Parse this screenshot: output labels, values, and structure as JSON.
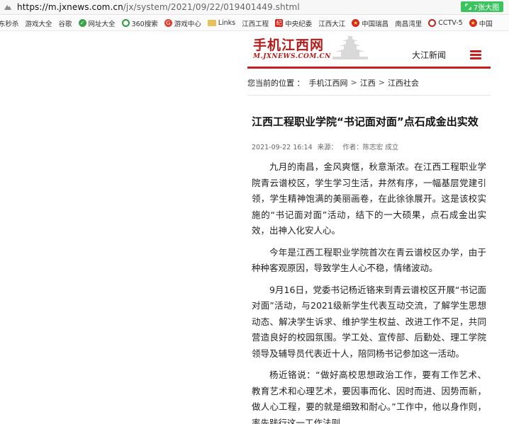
{
  "browser": {
    "url_host": "https://m.jxnews.com.cn",
    "url_path": "/jx/system/2021/09/22/019401449.shtml",
    "image_button": "7张大图"
  },
  "bookmarks": [
    {
      "label": "东秒杀",
      "icon": "none"
    },
    {
      "label": "游戏大全",
      "icon": "page"
    },
    {
      "label": "谷歌",
      "icon": "page"
    },
    {
      "label": "网址大全",
      "icon": "green"
    },
    {
      "label": "360搜索",
      "icon": "ring"
    },
    {
      "label": "游戏中心",
      "icon": "game"
    },
    {
      "label": "Links",
      "icon": "folder"
    },
    {
      "label": "江西工程",
      "icon": "page"
    },
    {
      "label": "中央纪委",
      "icon": "red"
    },
    {
      "label": "江西大江",
      "icon": "page"
    },
    {
      "label": "中国瑞昌",
      "icon": "emblem"
    },
    {
      "label": "南昌湾里",
      "icon": "page"
    },
    {
      "label": "CCTV-5",
      "icon": "cctv"
    },
    {
      "label": "中国",
      "icon": "emblem"
    }
  ],
  "header": {
    "logo_cn": "手机江西网",
    "logo_en": "M.JXNEWS.COM.CN",
    "channel": "大江新闻"
  },
  "breadcrumb": {
    "label": "您当前的位置 ：",
    "items": [
      "手机江西网",
      "江西",
      "江西社会"
    ],
    "separator": ">"
  },
  "article": {
    "title": "江西工程职业学院“书记面对面”点石成金出实效",
    "date": "2021-09-22 16:14",
    "source_label": "来源：",
    "author": "作者：陈志宏 成立",
    "paragraphs": [
      "九月的南昌，金风爽惬，秋意渐浓。在江西工程职业学院青云谱校区，学生学习生活，井然有序，一幅基层党建引领，学生精神饱满的美丽画卷，在此徐徐展开。这是该校实施的“书记面对面”活动，结下的一大硕果，点石成金出实效，出神入化安人心。",
      "今年是江西工程职业学院首次在青云谱校区办学，由于种种客观原因，导致学生人心不稳，情绪波动。",
      "9月16日，党委书记杨近铬来到青云谱校区开展“书记面对面”活动，与2021级新学生代表互动交流，了解学生思想动态、解决学生诉求、维护学生权益、改进工作不足，共同营造良好的校园氛围。学工处、宣传部、后勤处、理工学院领导及辅导员代表近十人，陪同杨书记参加这一活动。",
      "杨近铬说：“做好高校思想政治工作，要有工作艺术、教育艺术和心理艺术，要因事而化、因时而进、因势而新，做人心工程，要的就是细致和耐心。”工作中，他以身作则，率先践行这一工作法则"
    ]
  },
  "colors": {
    "brand_red": "#c71f1f",
    "image_button_green": "#3cc35f"
  }
}
